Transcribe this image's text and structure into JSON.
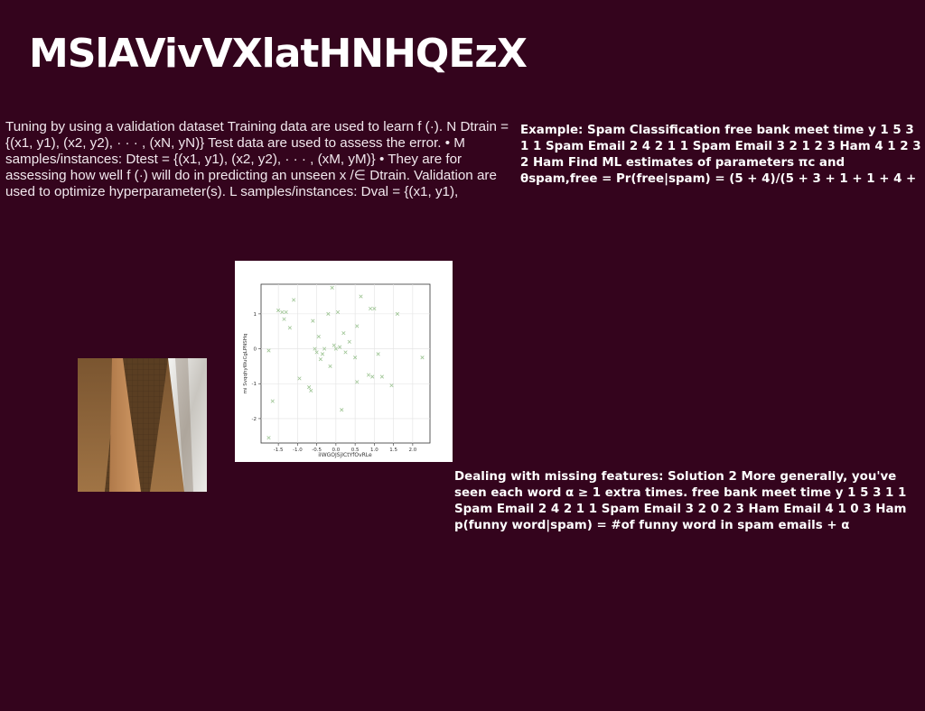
{
  "title": "MSlAVivVXlatHNHQEzX",
  "left_text": "Tuning by using a validation dataset Training data are used to learn f (·). N Dtrain = {(x1, y1), (x2, y2), · · · , (xN, yN)} Test data are used to assess the error. • M samples/instances: Dtest = {(x1, y1), (x2, y2), · · · , (xM, yM)} • They are for assessing how well f (·) will do in predicting an unseen x /∈ Dtrain. Validation are used to optimize hyperparameter(s). L samples/instances: Dval = {(x1, y1),",
  "right_text": "Example: Spam Classification free bank meet time y 1 5 3 1 1 Spam Email 2 4 2 1 1 Spam Email 3 2 1 2 3 Ham 4 1 2 3 2 Ham Find ML estimates of parameters πc and θspam,free = Pr(free|spam) = (5 + 4)/(5 + 3 + 1 + 1 + 4 +",
  "bottom_text": "Dealing with missing features: Solution 2 More generally, you've seen each word α ≥ 1 extra times. free bank meet time y 1 5 3 1 1 Spam Email 2 4 2 1 1 Spam Email 3 2 0 2 3 Ham Email 4 1 0 3 Ham p(funny word|spam) = #of funny word in spam emails + α",
  "colors": {
    "background": "#34041d",
    "marker": "#9dc493"
  },
  "chart_data": {
    "type": "scatter",
    "xlabel": "iIWGOJSjICtYfOvRLe",
    "ylabel": "mi SvqqhyWuCgLPNSHq",
    "xlim": [
      -1.95,
      2.45
    ],
    "ylim": [
      -2.7,
      1.85
    ],
    "xticks": [
      "-1.5",
      "-1.0",
      "-0.5",
      "0.0",
      "0.5",
      "1.0",
      "1.5",
      "2.0"
    ],
    "yticks": [
      "1",
      "0",
      "-1",
      "-2"
    ],
    "marker": "x",
    "grid": true,
    "x": [
      -1.75,
      -1.65,
      -1.5,
      -1.4,
      -1.35,
      -1.3,
      -1.2,
      -1.1,
      -0.95,
      -0.7,
      -0.65,
      -0.6,
      -0.55,
      -0.5,
      -0.45,
      -0.4,
      -0.35,
      -0.3,
      -0.2,
      -0.15,
      -0.1,
      -0.05,
      0.0,
      0.05,
      0.1,
      0.15,
      0.2,
      0.25,
      0.35,
      0.5,
      0.55,
      0.55,
      0.65,
      0.85,
      0.9,
      0.95,
      1.0,
      1.1,
      1.2,
      1.45,
      1.6,
      2.25,
      -1.75
    ],
    "y": [
      -2.55,
      -1.5,
      1.1,
      1.05,
      0.85,
      1.05,
      0.6,
      1.4,
      -0.85,
      -1.1,
      -1.2,
      0.8,
      0.0,
      -0.1,
      0.35,
      -0.3,
      -0.15,
      0.0,
      1.0,
      -0.5,
      1.75,
      0.1,
      0.0,
      1.05,
      0.05,
      -1.75,
      0.45,
      -0.1,
      0.2,
      -0.25,
      0.65,
      -0.95,
      1.5,
      -0.75,
      1.15,
      -0.8,
      1.15,
      -0.15,
      -0.8,
      -1.05,
      1.0,
      -0.25,
      -0.05
    ]
  }
}
